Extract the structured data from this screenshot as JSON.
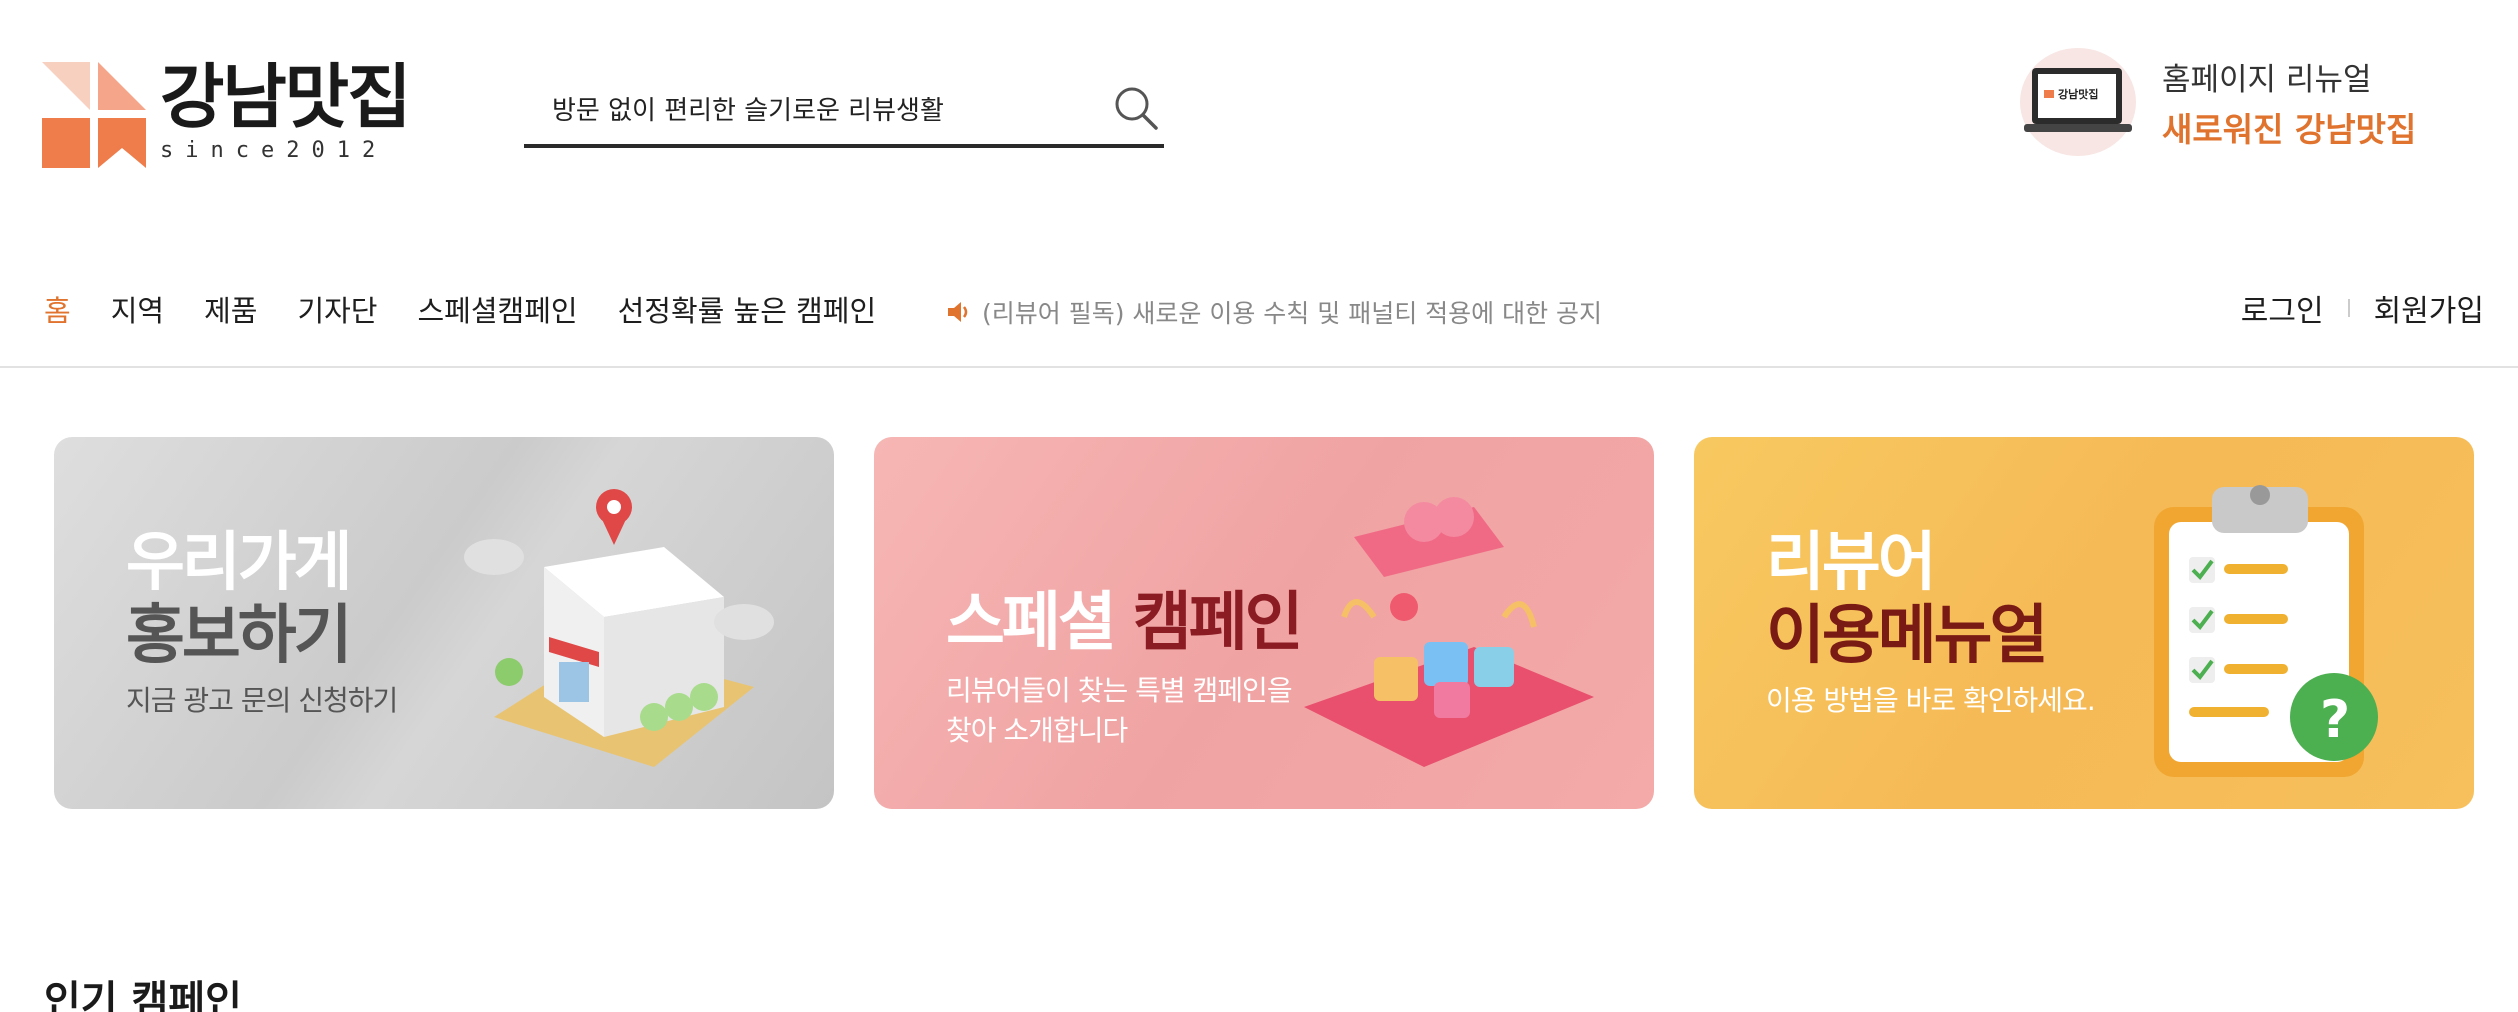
{
  "header": {
    "logo_title": "강남맛집",
    "logo_sub": "since2012",
    "search_value": "방문 없이 편리한 슬기로운 리뷰생활",
    "promo_line1": "홈페이지 리뉴얼",
    "promo_line2": "새로워진 강남맛집",
    "promo_screen_text": "강남맛집"
  },
  "nav": {
    "items": [
      "홈",
      "지역",
      "제품",
      "기자단",
      "스페셜캠페인",
      "선정확률 높은 캠페인"
    ],
    "notice": "(리뷰어 필독) 새로운 이용 수칙 및 패널티 적용에 대한 공지",
    "login": "로그인",
    "signup": "회원가입"
  },
  "banners": [
    {
      "line1": "우리가게",
      "line2": "홍보하기",
      "sub": "지금 광고 문의 신청하기"
    },
    {
      "line1": "스페셜",
      "accent": "캠페인",
      "sub1": "리뷰어들이 찾는 특별 캠페인을",
      "sub2": "찾아 소개합니다"
    },
    {
      "line1": "리뷰어",
      "line2": "이용메뉴얼",
      "sub": "이용 방법을 바로 확인하세요."
    }
  ],
  "section": {
    "title": "인기 캠페인"
  },
  "colors": {
    "accent": "#e0732e",
    "logo_light": "#f4b49a",
    "logo_dark": "#ee7d4b"
  },
  "icons": {
    "search": "search-icon",
    "notice": "speaker-icon"
  }
}
